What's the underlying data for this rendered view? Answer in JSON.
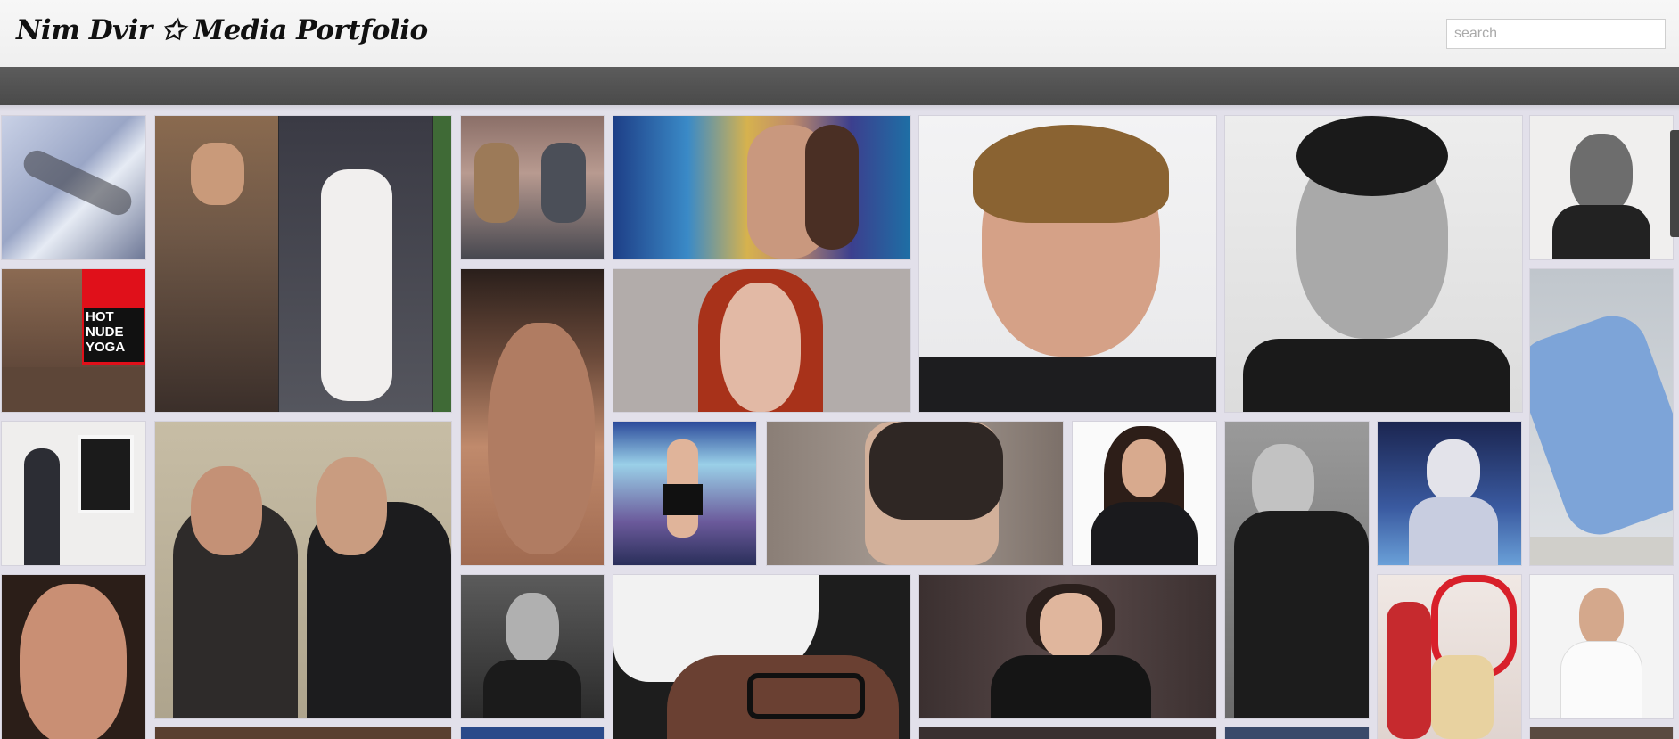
{
  "site": {
    "title": "Nim Dvir ✩ Media Portfolio"
  },
  "search": {
    "placeholder": "search",
    "value": ""
  },
  "tiles": [
    {
      "name": "snowy-stream",
      "text": ""
    },
    {
      "name": "jennifer-lopez-collage",
      "text": ""
    },
    {
      "name": "two-men-on-couch",
      "text": ""
    },
    {
      "name": "woman-colorful-poster",
      "text": ""
    },
    {
      "name": "smiling-man-brown-hair",
      "text": ""
    },
    {
      "name": "smiling-man-black-white",
      "text": ""
    },
    {
      "name": "man-paint-splatter",
      "text": ""
    },
    {
      "name": "hot-nude-yoga",
      "text": "HOT NUDE YOGA"
    },
    {
      "name": "man-close-up-face",
      "text": ""
    },
    {
      "name": "red-haired-woman",
      "text": ""
    },
    {
      "name": "man-lying-blue-shirt",
      "text": ""
    },
    {
      "name": "man-with-painting",
      "text": ""
    },
    {
      "name": "two-men-arguing",
      "text": ""
    },
    {
      "name": "singer-on-stage",
      "text": ""
    },
    {
      "name": "man-knit-scarf",
      "text": ""
    },
    {
      "name": "woman-dark-hair-arms-crossed",
      "text": ""
    },
    {
      "name": "short-haired-woman-bw",
      "text": ""
    },
    {
      "name": "pop-star-microphone",
      "text": ""
    },
    {
      "name": "woman-close-up-makeup",
      "text": ""
    },
    {
      "name": "man-portrait-bw",
      "text": ""
    },
    {
      "name": "man-white-cap-glasses",
      "text": ""
    },
    {
      "name": "woman-black-blazer",
      "text": ""
    },
    {
      "name": "cast-promo-poster",
      "text": ""
    },
    {
      "name": "man-white-tshirt",
      "text": ""
    }
  ]
}
